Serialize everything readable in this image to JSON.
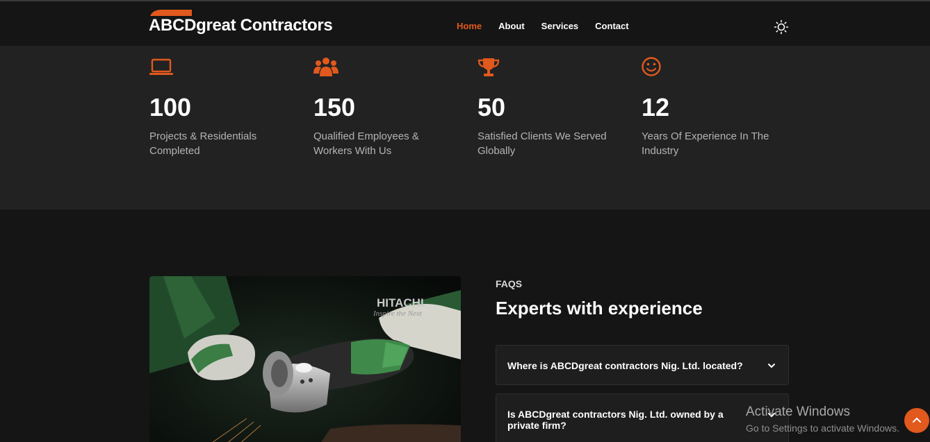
{
  "header": {
    "logo_text": "ABCDgreat Contractors",
    "nav": [
      "Home",
      "About",
      "Services",
      "Contact"
    ],
    "active_nav": "Home"
  },
  "stats": [
    {
      "icon": "laptop-icon",
      "value": "100",
      "label": "Projects & Residentials Completed"
    },
    {
      "icon": "users-icon",
      "value": "150",
      "label": "Qualified Employees & Workers With Us"
    },
    {
      "icon": "trophy-icon",
      "value": "50",
      "label": "Satisfied Clients We Served Globally"
    },
    {
      "icon": "smile-icon",
      "value": "12",
      "label": "Years Of Experience In The Industry"
    }
  ],
  "photo": {
    "brand_text": "HITACHI",
    "brand_tagline": "Inspire the Next"
  },
  "faq": {
    "eyebrow": "FAQS",
    "title": "Experts with experience",
    "items": [
      "Where is ABCDgreat contractors Nig. Ltd. located?",
      "Is ABCDgreat contractors Nig. Ltd. owned by a private firm?"
    ]
  },
  "watermark": {
    "line1": "Activate Windows",
    "line2": "Go to Settings to activate Windows."
  },
  "colors": {
    "accent": "#e2591d",
    "background": "#151515",
    "panel": "#222222"
  }
}
